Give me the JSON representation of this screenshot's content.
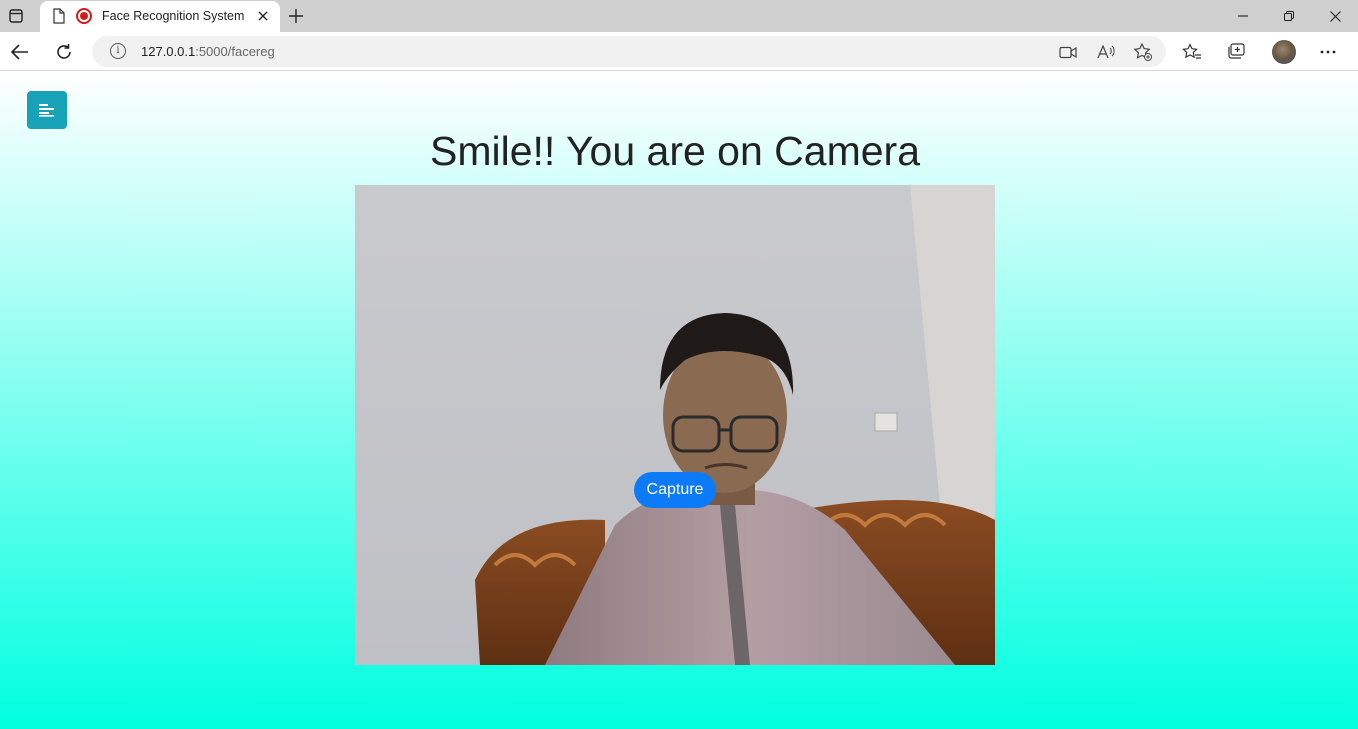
{
  "browser": {
    "tab": {
      "title": "Face Recognition System"
    },
    "address": {
      "host": "127.0.0.1",
      "path": ":5000/facereg"
    }
  },
  "page": {
    "title": "Smile!! You are on Camera",
    "capture_label": "Capture"
  },
  "icons": {
    "tab_actions": "tab-actions-icon",
    "page": "page-icon",
    "recording": "recording-icon",
    "close": "close-icon",
    "new_tab": "plus-icon",
    "back": "back-arrow-icon",
    "reload": "reload-icon",
    "info": "info-icon",
    "camera": "video-camera-icon",
    "read_aloud": "read-aloud-icon",
    "add_favorite": "add-favorite-icon",
    "favorites": "favorites-icon",
    "collections": "collections-icon",
    "more": "more-icon",
    "menu": "menu-icon"
  },
  "colors": {
    "menu_button": "#17a2b8",
    "capture_button": "#0d7bf7",
    "page_gradient_top": "#ffffff",
    "page_gradient_bottom": "#00ffe0",
    "recording": "#d51a1a"
  }
}
